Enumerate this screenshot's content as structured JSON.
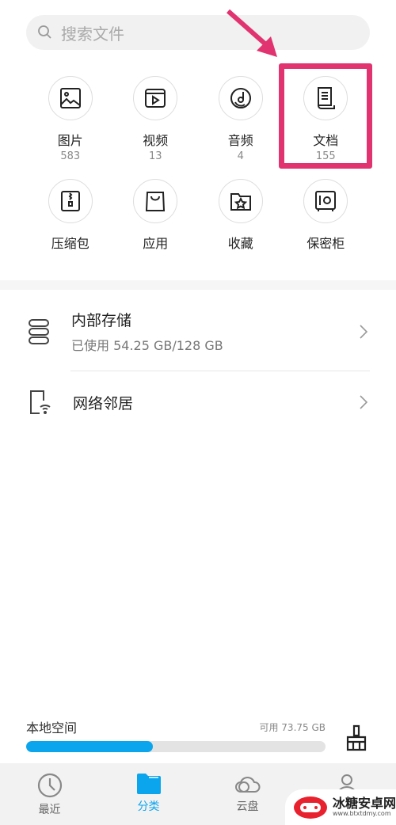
{
  "search": {
    "placeholder": "搜索文件",
    "icon": "search-icon"
  },
  "categories": [
    {
      "label": "图片",
      "count": "583",
      "icon": "image-icon"
    },
    {
      "label": "视频",
      "count": "13",
      "icon": "video-icon"
    },
    {
      "label": "音频",
      "count": "4",
      "icon": "music-icon"
    },
    {
      "label": "文档",
      "count": "155",
      "icon": "document-icon"
    },
    {
      "label": "压缩包",
      "icon": "zip-icon"
    },
    {
      "label": "应用",
      "icon": "shopping-bag-icon"
    },
    {
      "label": "收藏",
      "icon": "star-folder-icon"
    },
    {
      "label": "保密柜",
      "icon": "safe-icon"
    }
  ],
  "storage": {
    "title": "内部存储",
    "subtitle": "已使用 54.25 GB/128 GB"
  },
  "network": {
    "title": "网络邻居"
  },
  "local": {
    "title": "本地空间",
    "available": "可用 73.75 GB",
    "used_fraction": 0.424,
    "bar_color": "#0ba5ee"
  },
  "nav": [
    {
      "label": "最近",
      "icon": "clock-icon"
    },
    {
      "label": "分类",
      "icon": "folder-icon",
      "active": true
    },
    {
      "label": "云盘",
      "icon": "cloud-icon"
    },
    {
      "label": "",
      "icon": "person-icon"
    }
  ],
  "annotation": {
    "color": "#e0336f"
  },
  "watermark": {
    "text": "冰糖安卓网",
    "url": "www.btxtdmy.com"
  }
}
